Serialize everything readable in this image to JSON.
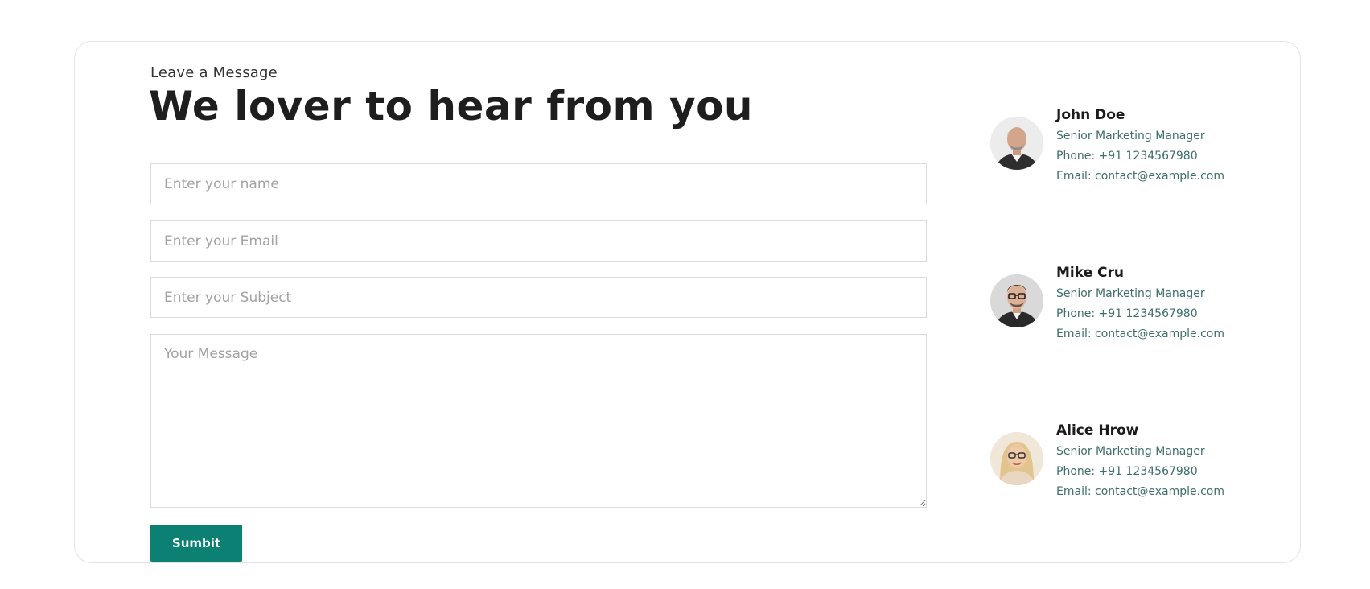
{
  "form": {
    "eyebrow": "Leave a Message",
    "headline": "We lover to hear from you",
    "name_placeholder": "Enter your name",
    "email_placeholder": "Enter your Email",
    "subject_placeholder": "Enter your Subject",
    "message_placeholder": "Your Message",
    "submit_label": "Sumbit"
  },
  "contacts": [
    {
      "name": "John Doe",
      "role": "Senior Marketing Manager",
      "phone": "Phone: +91 1234567980",
      "email": "Email: contact@example.com"
    },
    {
      "name": "Mike Cru",
      "role": "Senior Marketing Manager",
      "phone": "Phone: +91 1234567980",
      "email": "Email: contact@example.com"
    },
    {
      "name": "Alice Hrow",
      "role": "Senior Marketing Manager",
      "phone": "Phone: +91 1234567980",
      "email": "Email: contact@example.com"
    }
  ],
  "colors": {
    "accent": "#0b8073",
    "contact_text": "#3f6f6a",
    "border": "#dcdcdc"
  }
}
